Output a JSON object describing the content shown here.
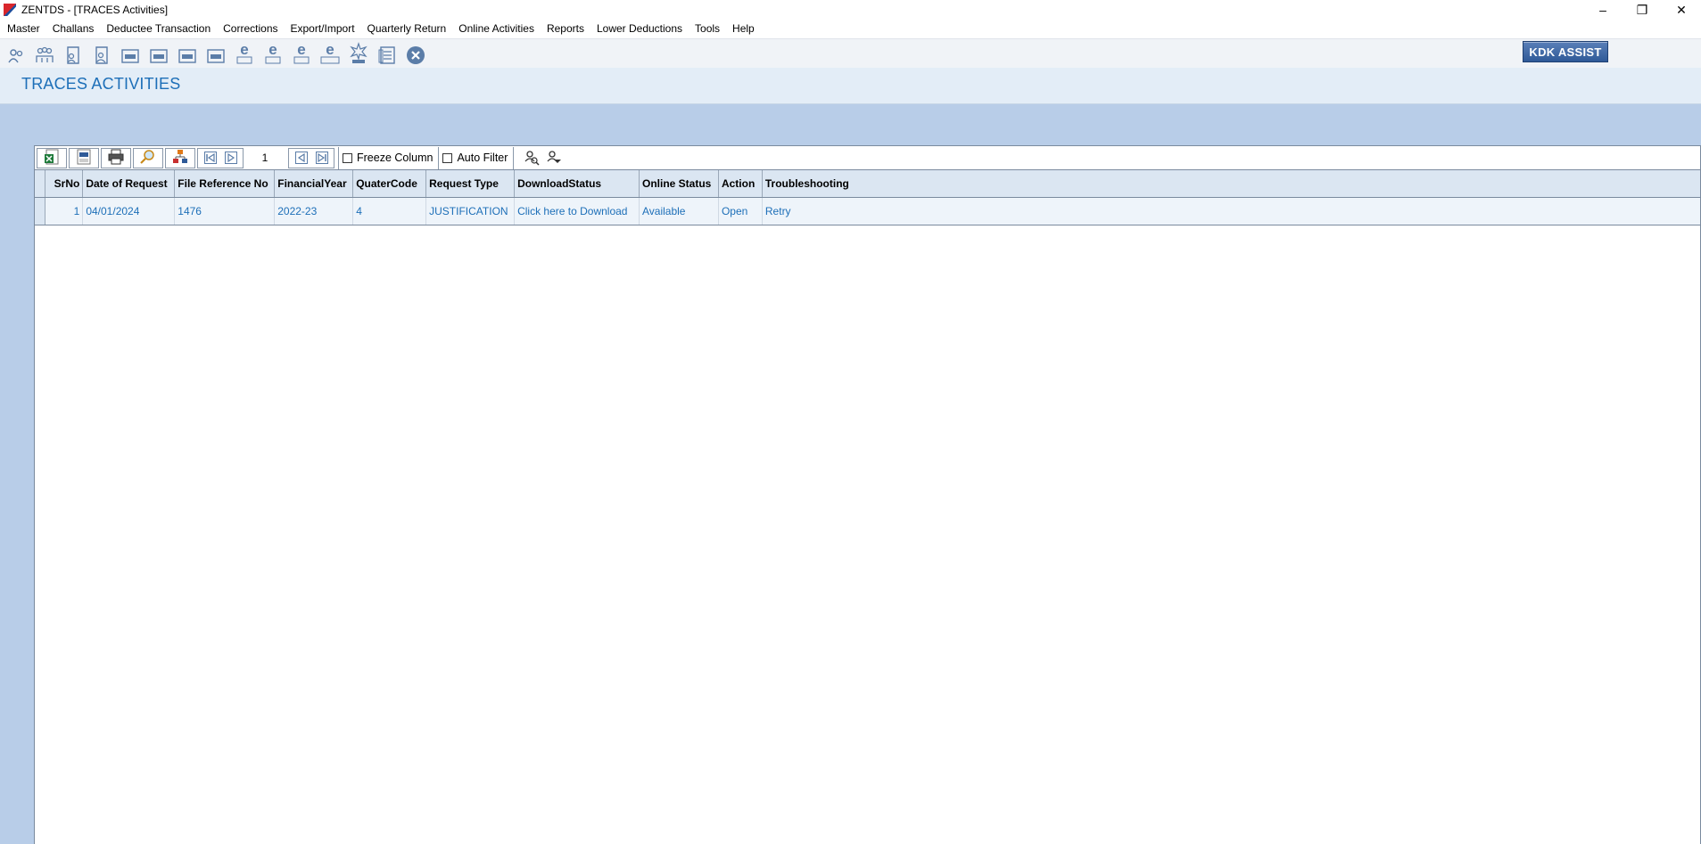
{
  "window": {
    "title": "ZENTDS - [TRACES Activities]",
    "minimize": "–",
    "restore": "❐",
    "close": "✕"
  },
  "menu": [
    "Master",
    "Challans",
    "Deductee Transaction",
    "Corrections",
    "Export/Import",
    "Quarterly Return",
    "Online Activities",
    "Reports",
    "Lower Deductions",
    "Tools",
    "Help"
  ],
  "toolbar": {
    "icons": [
      "deductor-icon",
      "deductors-group-icon",
      "form-24q-icon",
      "form-26q-icon",
      "form-24q-badge-icon",
      "form-26q-badge-icon",
      "form-27q-badge-icon",
      "form-27eq-badge-icon",
      "e-24q-icon",
      "e-26q-icon",
      "e-27q-icon",
      "e-27eq-icon",
      "tds-icon",
      "document-list-icon",
      "close-circle-icon"
    ],
    "kdk_assist": "KDK ASSIST"
  },
  "page": {
    "title": "TRACES ACTIVITIES"
  },
  "grid_toolbar": {
    "page_number": "1",
    "freeze_column": "Freeze Column",
    "auto_filter": "Auto Filter"
  },
  "table": {
    "columns": [
      "SrNo",
      "Date of Request",
      "File Reference No",
      "FinancialYear",
      "QuaterCode",
      "Request Type",
      "DownloadStatus",
      "Online Status",
      "Action",
      "Troubleshooting"
    ],
    "rows": [
      [
        "1",
        "04/01/2024",
        "1476",
        "2022-23",
        "4",
        "JUSTIFICATION",
        "Click here to Download",
        "Available",
        "Open",
        "Retry"
      ]
    ]
  },
  "colors": {
    "accent": "#1d6fb8",
    "background": "#b8cde8",
    "header_bg": "#dbe6f2"
  }
}
